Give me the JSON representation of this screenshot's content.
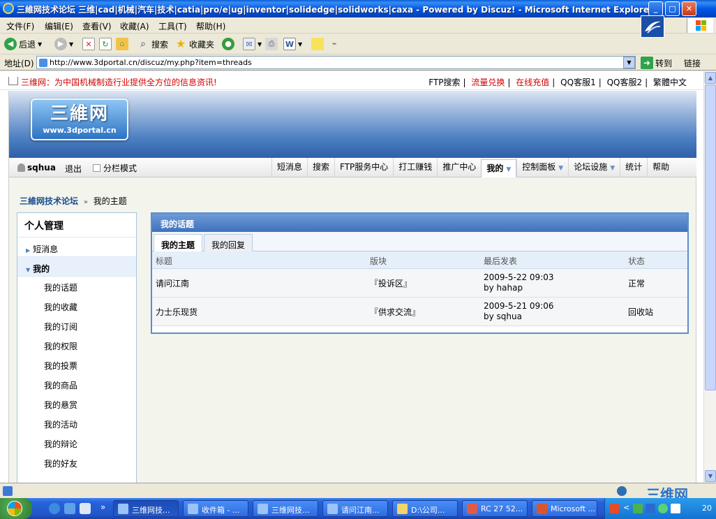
{
  "window": {
    "title": "三維网技术论坛 三维|cad|机械|汽车|技术|catia|pro/e|ug|inventor|solidedge|solidworks|caxa - Powered by Discuz! - Microsoft Internet Explorer",
    "min": "_",
    "max": "□",
    "close": "✕"
  },
  "menu": [
    "文件(F)",
    "编辑(E)",
    "查看(V)",
    "收藏(A)",
    "工具(T)",
    "帮助(H)"
  ],
  "toolbar": {
    "back": "后退",
    "search": "搜索",
    "favorites": "收藏夹"
  },
  "address": {
    "label": "地址(D)",
    "url": "http://www.3dportal.cn/discuz/my.php?item=threads",
    "go": "转到",
    "links": "链接"
  },
  "topstrip": {
    "slogan": "三维网：为中国机械制造行业提供全方位的信息资讯!",
    "links": [
      "FTP搜索",
      "流量兑换",
      "在线充值",
      "QQ客服1",
      "QQ客服2",
      "繁體中文"
    ],
    "seps": [
      "|",
      "|",
      "|",
      "|",
      "|"
    ]
  },
  "logo": {
    "title": "三維网",
    "url": "www.3dportal.cn"
  },
  "nav": {
    "username": "sqhua",
    "logout": "退出",
    "split_mode": "分栏模式",
    "links": [
      "短消息",
      "搜索",
      "FTP服务中心",
      "打工赚钱",
      "推广中心"
    ],
    "active": "我的",
    "dropdowns": [
      "控制面板",
      "论坛设施"
    ],
    "tail": [
      "统计",
      "帮助"
    ]
  },
  "breadcrumb": {
    "home": "三維网技术论坛",
    "sep": "»",
    "current": "我的主题"
  },
  "sidebar": {
    "title": "个人管理",
    "sections": [
      {
        "label": "短消息",
        "open": false
      },
      {
        "label": "我的",
        "open": true
      }
    ],
    "items": [
      "我的话题",
      "我的收藏",
      "我的订阅",
      "我的权限",
      "我的投票",
      "我的商品",
      "我的悬赏",
      "我的活动",
      "我的辩论",
      "我的好友"
    ]
  },
  "main": {
    "heading": "我的话题",
    "tabs": [
      "我的主题",
      "我的回复"
    ],
    "columns": [
      "标题",
      "版块",
      "最后发表",
      "状态"
    ],
    "rows": [
      {
        "title": "请问江南",
        "forum": "『投诉区』",
        "last_time": "2009-5-22 09:03",
        "last_by": "by hahap",
        "status": "正常"
      },
      {
        "title": "力士乐现货",
        "forum": "『供求交流』",
        "last_time": "2009-5-21 09:06",
        "last_by": "by sqhua",
        "status": "回收站"
      }
    ]
  },
  "taskbar": {
    "tasks": [
      "三维网技...",
      "收件箱 - ...",
      "三维网技...",
      "请问江南...",
      "D:\\公司...",
      "RC 27 52...",
      "Microsoft ..."
    ],
    "clock": "20"
  },
  "statusbar": {
    "watermark": "三维网"
  },
  "colors": {
    "accent": "#3E72BC",
    "slogan": "#D40000",
    "breadcrumb": "#1A4E8E"
  }
}
